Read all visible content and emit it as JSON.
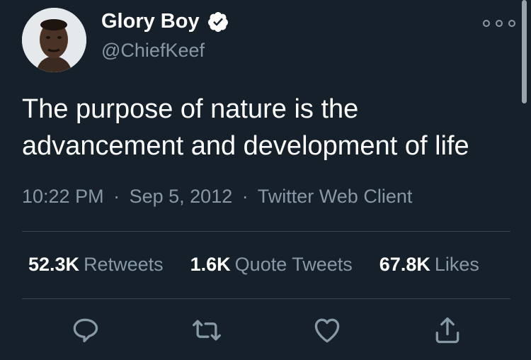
{
  "user": {
    "display_name": "Glory Boy",
    "handle": "@ChiefKeef",
    "verified": true
  },
  "tweet": {
    "text": "The purpose of nature is the advancement and development of life",
    "time": "10:22 PM",
    "date": "Sep 5, 2012",
    "client": "Twitter Web Client",
    "separator": "·"
  },
  "stats": {
    "retweets": {
      "count": "52.3K",
      "label": "Retweets"
    },
    "quotes": {
      "count": "1.6K",
      "label": "Quote Tweets"
    },
    "likes": {
      "count": "67.8K",
      "label": "Likes"
    }
  },
  "icons": {
    "more": "more-options-icon",
    "reply": "reply-icon",
    "retweet": "retweet-icon",
    "like": "heart-icon",
    "share": "share-icon",
    "verified": "verified-badge-icon"
  },
  "colors": {
    "background": "#15202b",
    "primary_text": "#ffffff",
    "secondary_text": "#8899a6",
    "divider": "#38444d"
  }
}
